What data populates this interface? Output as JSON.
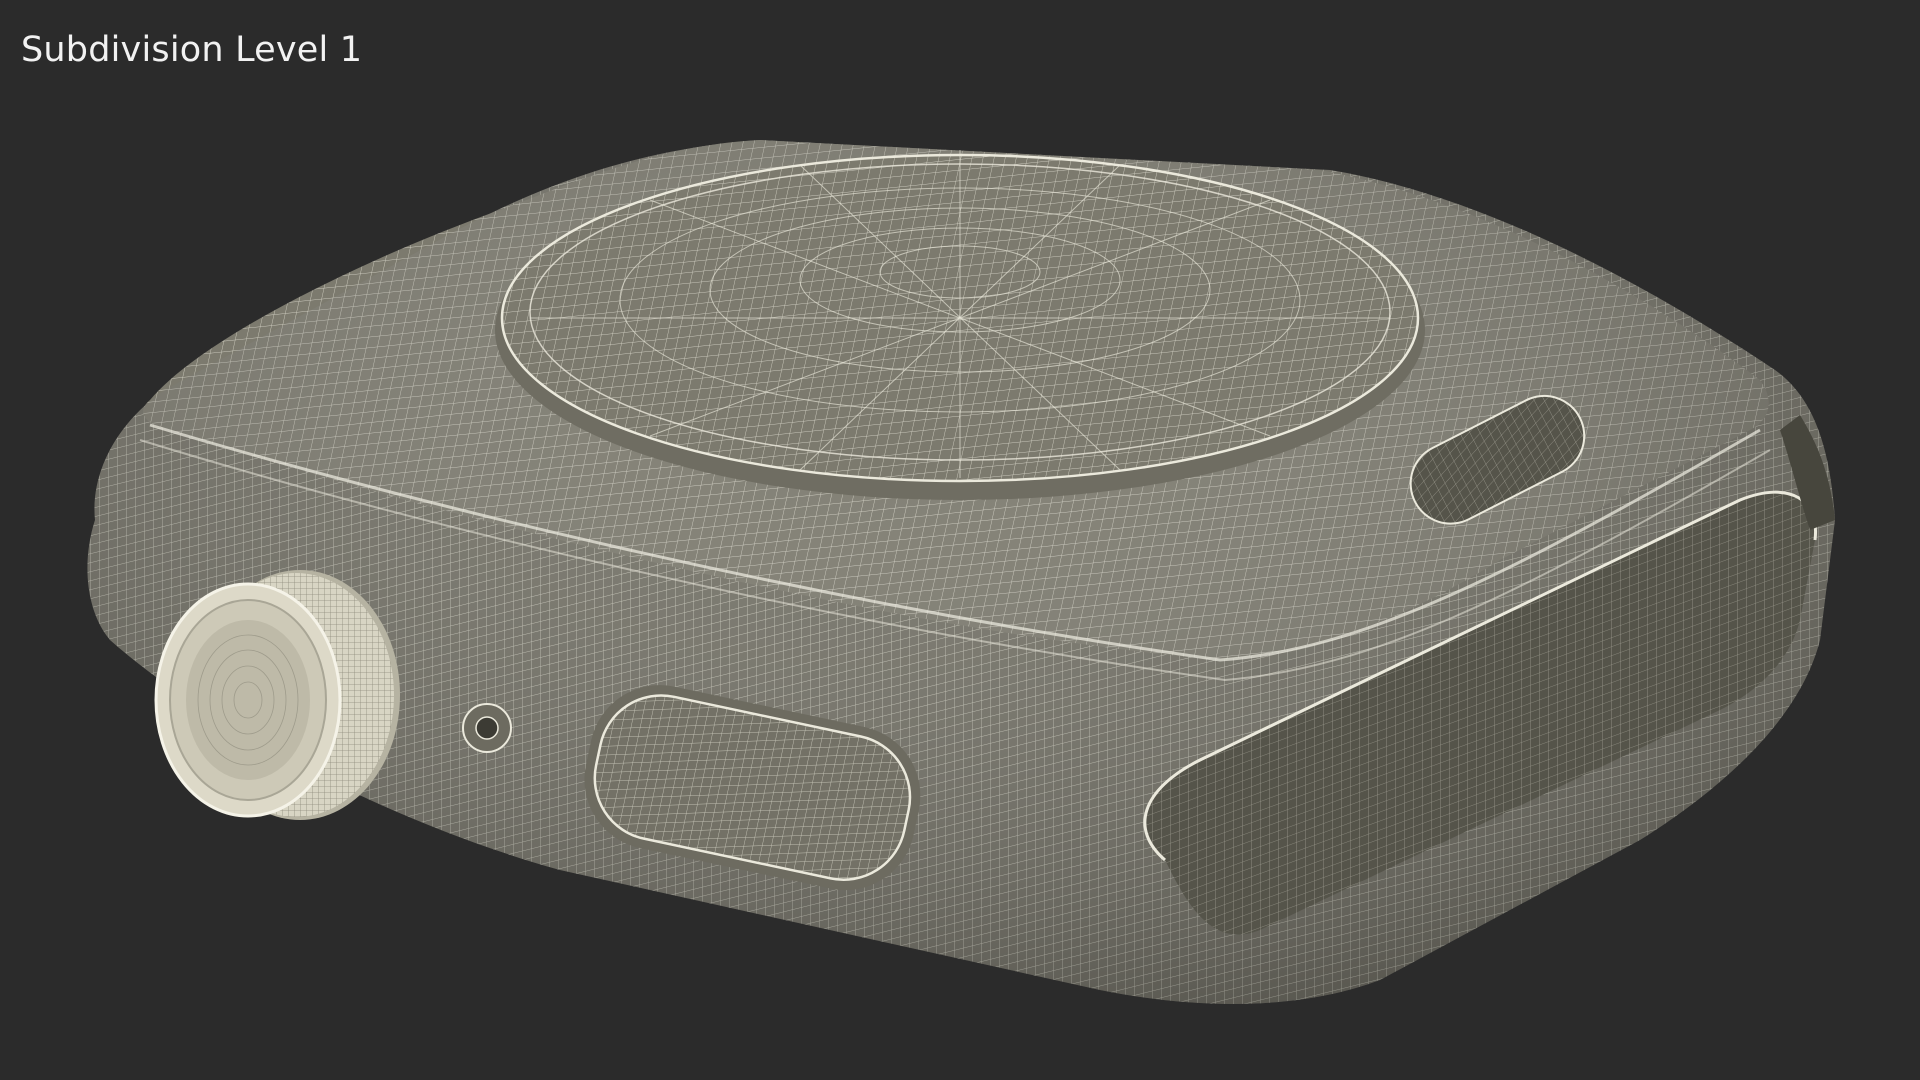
{
  "viewport": {
    "label": "Subdivision Level 1"
  },
  "colors": {
    "background": "#2b2b2b",
    "surface": "#7c7a6e",
    "wire": "#e9e7da",
    "shadow": "#4a493f"
  }
}
